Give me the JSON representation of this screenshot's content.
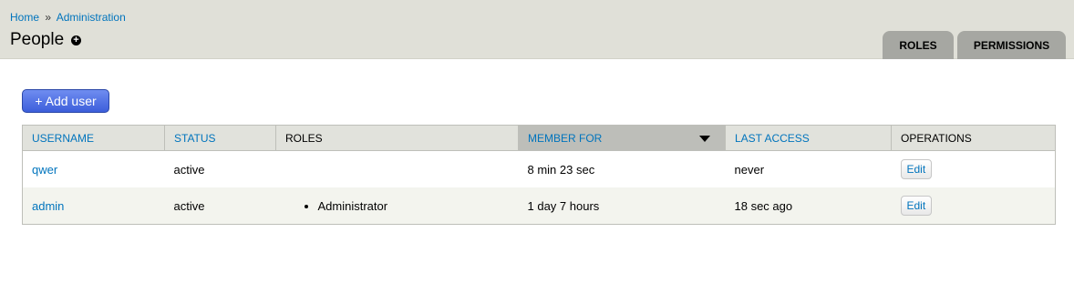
{
  "breadcrumb": {
    "home": "Home",
    "separator": "»",
    "admin": "Administration"
  },
  "page": {
    "title": "People",
    "shortcut_icon": "add-shortcut-icon"
  },
  "tabs": [
    {
      "label": "ROLES"
    },
    {
      "label": "PERMISSIONS"
    }
  ],
  "actions": {
    "add_user": "+ Add user"
  },
  "table": {
    "columns": [
      "USERNAME",
      "STATUS",
      "ROLES",
      "MEMBER FOR",
      "LAST ACCESS",
      "OPERATIONS"
    ],
    "sorted_column": "MEMBER FOR",
    "rows": [
      {
        "username": "qwer",
        "status": "active",
        "roles": [],
        "member_for": "8 min 23 sec",
        "last_access": "never",
        "operation": "Edit"
      },
      {
        "username": "admin",
        "status": "active",
        "roles": [
          "Administrator"
        ],
        "member_for": "1 day 7 hours",
        "last_access": "18 sec ago",
        "operation": "Edit"
      }
    ]
  },
  "colors": {
    "header_bg": "#e0e0d8",
    "link": "#0074bd",
    "tab_bg": "#a6a7a2",
    "button_bg": "#4a6ee0",
    "row_alt": "#f3f4ee"
  }
}
